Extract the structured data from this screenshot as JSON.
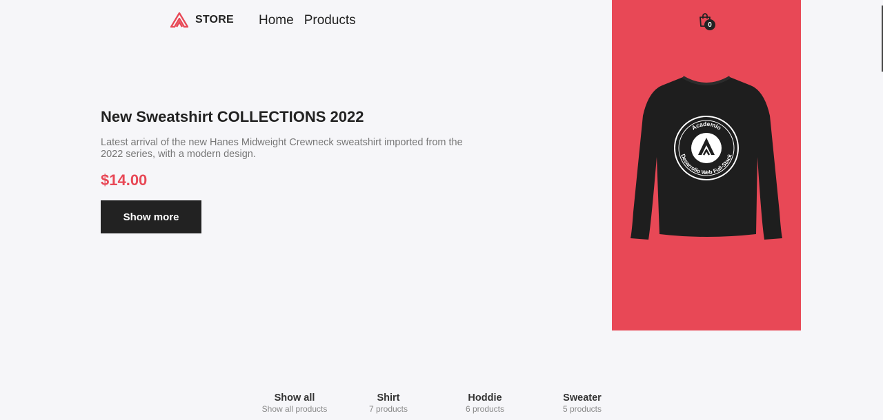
{
  "header": {
    "logo_text": "STORE",
    "nav": [
      "Home",
      "Products"
    ],
    "cart_count": "0"
  },
  "hero": {
    "title": "New Sweatshirt COLLECTIONS 2022",
    "description": "Latest arrival of the new Hanes Midweight Crewneck sweatshirt imported from the 2022 series, with a modern design.",
    "price": "$14.00",
    "button_label": "Show more",
    "shirt_print_top": "Academlo",
    "shirt_print_bottom": "Desarrollo Web Full-Stack"
  },
  "categories": [
    {
      "name": "Show all",
      "count": "Show all products"
    },
    {
      "name": "Shirt",
      "count": "7 products"
    },
    {
      "name": "Hoddie",
      "count": "6 products"
    },
    {
      "name": "Sweater",
      "count": "5 products"
    }
  ],
  "colors": {
    "accent": "#e84856",
    "dark": "#222222",
    "background": "#f6f6f9"
  }
}
